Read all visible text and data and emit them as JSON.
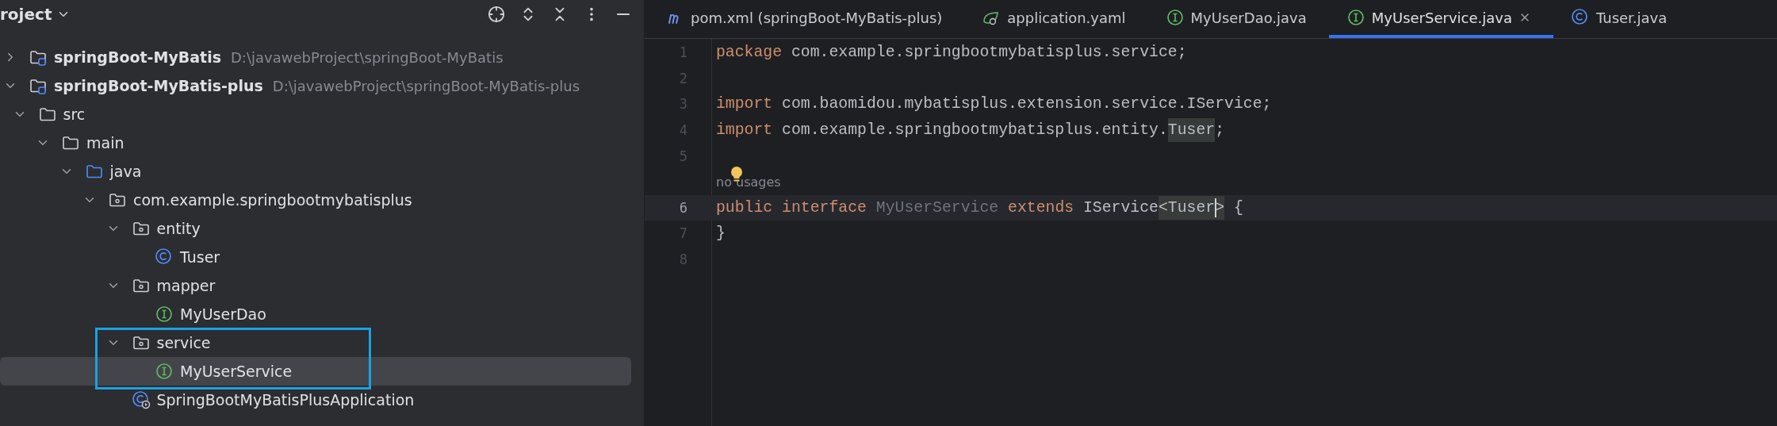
{
  "project_panel": {
    "title": "roject"
  },
  "tree": [
    {
      "label": "springBoot-MyBatis",
      "path": "D:\\javawebProject\\springBoot-MyBatis",
      "kind": "module",
      "expanded": false,
      "selected": false
    },
    {
      "label": "springBoot-MyBatis-plus",
      "path": "D:\\javawebProject\\springBoot-MyBatis-plus",
      "kind": "module",
      "expanded": true,
      "selected": false,
      "children": [
        {
          "label": "src",
          "kind": "folder",
          "expanded": true,
          "selected": false,
          "children": [
            {
              "label": "main",
              "kind": "folder",
              "expanded": true,
              "selected": false,
              "children": [
                {
                  "label": "java",
                  "kind": "source-folder",
                  "expanded": true,
                  "selected": false,
                  "children": [
                    {
                      "label": "com.example.springbootmybatisplus",
                      "kind": "package",
                      "expanded": true,
                      "selected": false,
                      "children": [
                        {
                          "label": "entity",
                          "kind": "package",
                          "expanded": true,
                          "selected": false,
                          "children": [
                            {
                              "label": "Tuser",
                              "kind": "class",
                              "selected": false
                            }
                          ]
                        },
                        {
                          "label": "mapper",
                          "kind": "package",
                          "expanded": true,
                          "selected": false,
                          "children": [
                            {
                              "label": "MyUserDao",
                              "kind": "interface",
                              "selected": false
                            }
                          ]
                        },
                        {
                          "label": "service",
                          "kind": "package",
                          "expanded": true,
                          "selected": false,
                          "outlined": true,
                          "children": [
                            {
                              "label": "MyUserService",
                              "kind": "interface",
                              "selected": true
                            }
                          ]
                        },
                        {
                          "label": "SpringBootMyBatisPlusApplication",
                          "kind": "app-class",
                          "selected": false
                        }
                      ]
                    }
                  ]
                }
              ]
            }
          ]
        }
      ]
    }
  ],
  "tabs": [
    {
      "label": "pom.xml (springBoot-MyBatis-plus)",
      "kind": "maven",
      "selected": false
    },
    {
      "label": "application.yaml",
      "kind": "yaml",
      "selected": false
    },
    {
      "label": "MyUserDao.java",
      "kind": "interface",
      "selected": false
    },
    {
      "label": "MyUserService.java",
      "kind": "interface",
      "selected": true
    },
    {
      "label": "Tuser.java",
      "kind": "class",
      "selected": false
    }
  ],
  "editor_lines": [
    {
      "kind": "code",
      "number": "1",
      "current": false,
      "tokens": [
        {
          "text": "package",
          "kind": "keyword"
        },
        {
          "text": " com.example.springbootmybatisplus.service;",
          "kind": "plain"
        }
      ]
    },
    {
      "kind": "code",
      "number": "2",
      "current": false
    },
    {
      "kind": "code",
      "number": "3",
      "current": false,
      "tokens": [
        {
          "text": "import",
          "kind": "keyword"
        },
        {
          "text": " com.baomidou.mybatisplus.extension.service.IService;",
          "kind": "plain"
        }
      ]
    },
    {
      "kind": "code",
      "number": "4",
      "current": false,
      "tokens": [
        {
          "text": "import",
          "kind": "keyword"
        },
        {
          "text": " com.example.springbootmybatisplus.entity.",
          "kind": "plain"
        },
        {
          "text": "Tuser",
          "kind": "match"
        },
        {
          "text": ";",
          "kind": "plain"
        }
      ]
    },
    {
      "kind": "code",
      "number": "5",
      "current": false
    },
    {
      "kind": "inlay",
      "text": "no usages",
      "intention_bulb": true
    },
    {
      "kind": "code",
      "number": "6",
      "current": true,
      "tokens": [
        {
          "text": "public",
          "kind": "keyword"
        },
        {
          "text": " interface",
          "kind": "keyword"
        },
        {
          "text": " MyUserService",
          "kind": "unused"
        },
        {
          "text": " extends",
          "kind": "keyword"
        },
        {
          "text": " IService",
          "kind": "plain"
        },
        {
          "text": "<Tuser",
          "kind": "match"
        },
        {
          "text": ">",
          "kind": "match",
          "caret_before": true
        },
        {
          "text": " {",
          "kind": "plain"
        }
      ]
    },
    {
      "kind": "code",
      "number": "7",
      "current": false,
      "tokens": [
        {
          "text": "}",
          "kind": "plain"
        }
      ]
    },
    {
      "kind": "code",
      "number": "8",
      "current": false
    }
  ]
}
